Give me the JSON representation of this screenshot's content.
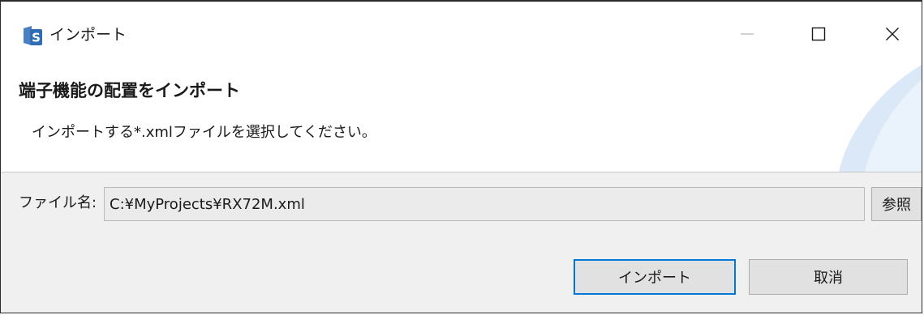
{
  "window": {
    "title": "インポート",
    "icon": "renesas-s-icon",
    "controls": {
      "minimize": "minimize-icon",
      "maximize": "maximize-icon",
      "close": "close-icon"
    }
  },
  "header": {
    "title": "端子機能の配置をインポート",
    "description": "インポートする*.xmlファイルを選択してください。"
  },
  "file": {
    "label": "ファイル名:",
    "value": "C:¥MyProjects¥RX72M.xml",
    "browse_label": "参照"
  },
  "buttons": {
    "import_label": "インポート",
    "cancel_label": "取消"
  },
  "colors": {
    "accent": "#0078d7",
    "icon_blue": "#2e6db4",
    "swoosh": "#dbe8f7"
  }
}
